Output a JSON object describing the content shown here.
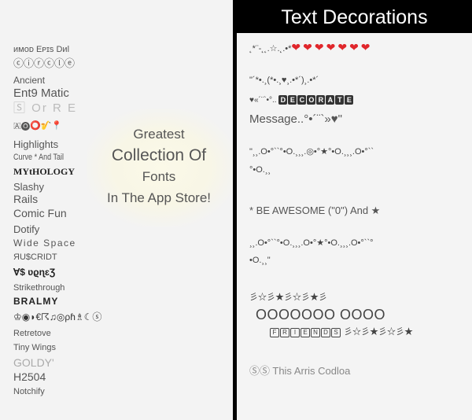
{
  "left_panel": {
    "font_styles": [
      "ᴎᴍᴏᴅ Eᴩɪs Dᴎl",
      "ⓒⓘⓡⓒⓛⓔ",
      "Ancient",
      "Ent9 Matic",
      "🅂 Or R E",
      "🇦🅞⭕🎷📍",
      "Highlights",
      "Curve * And Tail",
      "MYtHOLOGY",
      "Slashy",
      "Rails",
      "Comic Fun",
      "Dotify",
      "Wide Space",
      "ЯU$CRIDT",
      "∀$ ʋϱɳɛƷ",
      "Strikethrough",
      "BRALMY",
      "♔◉◗€☈♫◎ρɦ♗☾ⓢ",
      "Retretove",
      "Tiny Wings",
      "GOLDY'",
      "H2504",
      "Notchify"
    ],
    "promo": {
      "line1": "Greatest",
      "line2": "Collection Of",
      "line3": "Fonts",
      "line4": "In The App Store!"
    }
  },
  "right_panel": {
    "header_title": "Text Decorations",
    "decorations": {
      "stars_prefix": "˛*¨-˛˛.☆.˛.•*",
      "hearts": "❤❤❤❤❤❤❤",
      "line2": "\"´*•.¸(*•.¸♥¸.•*´)¸.•*´",
      "line3_prefix": "♥«´¨`•°..",
      "decorate_letters": [
        "D",
        "E",
        "C",
        "O",
        "R",
        "A",
        "T",
        "E"
      ],
      "line4": "Message..°•´¨`»♥\"",
      "line5a": "\"¸¸.O•°``°•O.¸¸¸.◎•°★°•O.¸¸¸.O•°``",
      "line5b": "°•O.¸¸",
      "line6": "* BE AWESOME (\"0\") And ★",
      "line7a": "¸¸.O•°``°•O.¸¸¸.O•°★°•O.¸¸¸.O•°``°",
      "line7b": "•O.¸¸\"",
      "line8": "彡☆彡★彡☆彡★彡",
      "line9": "OOOOOOO OOOO",
      "friends_letters": [
        "F",
        "R",
        "I",
        "E",
        "N",
        "D",
        "S"
      ],
      "line10_suffix": "彡☆彡★彡☆彡★",
      "line11": "ⓈⓈ This Arris Codloa"
    }
  },
  "colors": {
    "header_bg": "#000000",
    "header_text": "#ffffff",
    "heart": "#e0262b",
    "text": "#555555"
  }
}
